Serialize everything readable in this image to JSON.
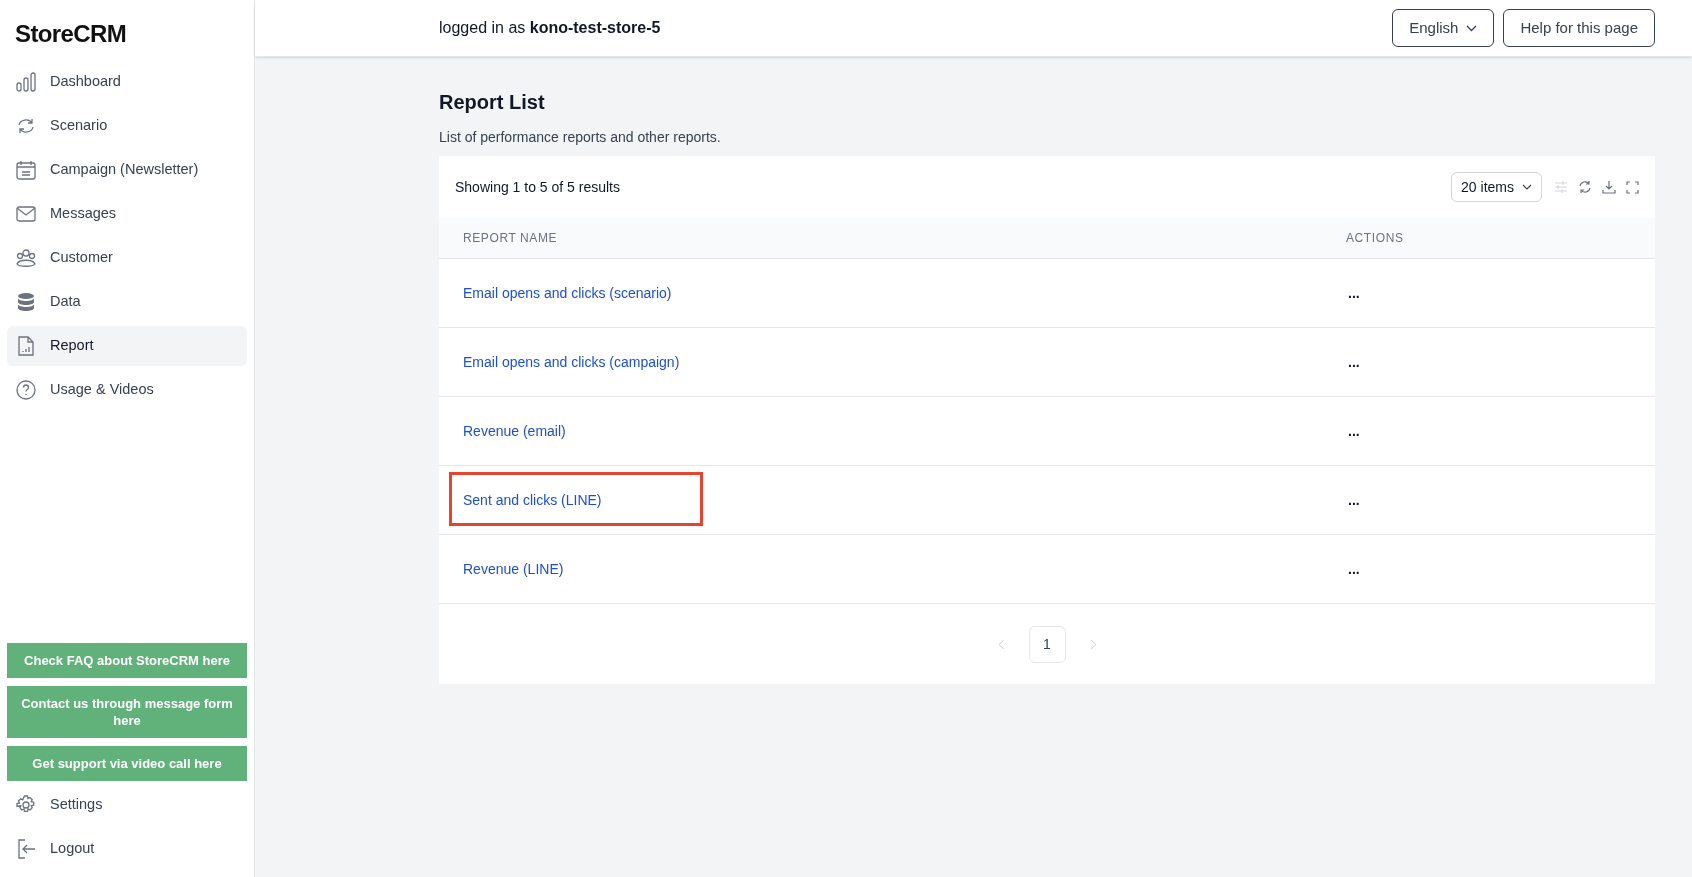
{
  "brand": "StoreCRM",
  "sidebar": {
    "items": [
      {
        "label": "Dashboard",
        "selected": false
      },
      {
        "label": "Scenario",
        "selected": false
      },
      {
        "label": "Campaign (Newsletter)",
        "selected": false
      },
      {
        "label": "Messages",
        "selected": false
      },
      {
        "label": "Customer",
        "selected": false
      },
      {
        "label": "Data",
        "selected": false
      },
      {
        "label": "Report",
        "selected": true
      },
      {
        "label": "Usage & Videos",
        "selected": false
      }
    ],
    "support_links": [
      "Check FAQ about StoreCRM here",
      "Contact us through message form here",
      "Get support via video call here"
    ],
    "bottom_items": [
      {
        "label": "Settings"
      },
      {
        "label": "Logout"
      }
    ]
  },
  "header": {
    "login": "logged in as **kono-test-store-5**",
    "language": "English",
    "help": "Help for this page"
  },
  "page": {
    "title": "Report List",
    "subtitle": "List of performance reports and other reports."
  },
  "table": {
    "summary": "Showing 1 to 5 of 5 results",
    "page_size": "20 items",
    "columns": [
      "REPORT NAME",
      "ACTIONS"
    ],
    "rows": [
      {
        "name": "Email opens and clicks (scenario)",
        "actions": "...",
        "highlighted": false
      },
      {
        "name": "Email opens and clicks (campaign)",
        "actions": "...",
        "highlighted": false
      },
      {
        "name": "Revenue (email)",
        "actions": "...",
        "highlighted": false
      },
      {
        "name": "Sent and clicks (LINE)",
        "actions": "...",
        "highlighted": true
      },
      {
        "name": "Revenue (LINE)",
        "actions": "...",
        "highlighted": false
      }
    ],
    "pages": [
      {
        "label": "1",
        "selected": true
      }
    ]
  }
}
